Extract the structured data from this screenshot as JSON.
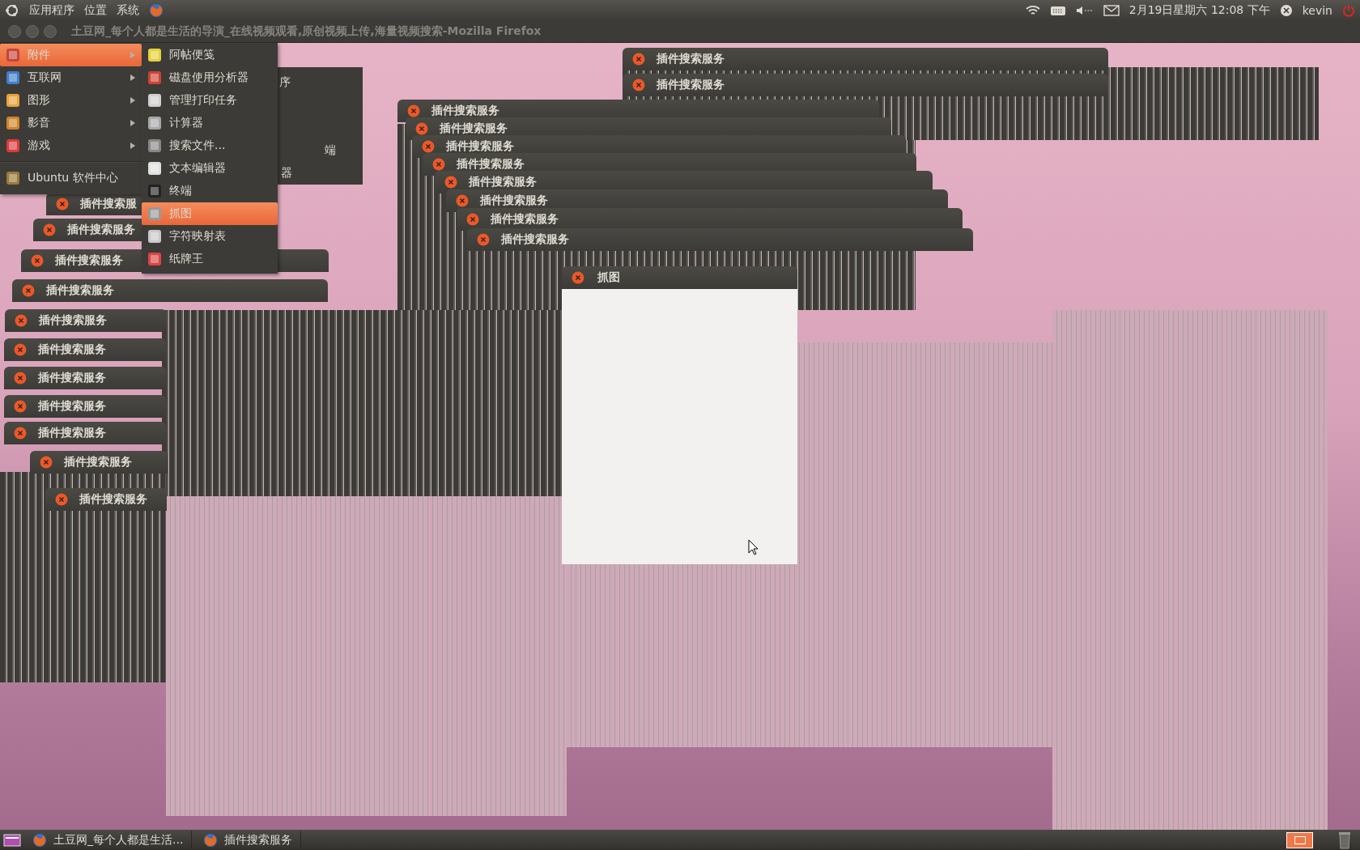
{
  "top_panel": {
    "menus": [
      {
        "label": "应用程序"
      },
      {
        "label": "位置"
      },
      {
        "label": "系统"
      }
    ],
    "clock": "2月19日星期六 12:08 下午",
    "user": "kevin"
  },
  "browser_titlebar": {
    "title": "土豆网_每个人都是生活的导演_在线视频观看,原创视频上传,海量视频搜索-Mozilla Firefox"
  },
  "fragments": [
    "序",
    "端",
    "器"
  ],
  "dialogs": [
    {
      "title": "插件搜索服务"
    },
    {
      "title": "插件搜索服务"
    },
    {
      "title": "插件搜索服务"
    },
    {
      "title": "插件搜索服务"
    },
    {
      "title": "插件搜索服务"
    },
    {
      "title": "插件搜索服务"
    },
    {
      "title": "插件搜索服务"
    },
    {
      "title": "插件搜索服务"
    },
    {
      "title": "插件搜索服务"
    },
    {
      "title": "插件搜索服务"
    },
    {
      "title": "插件搜索服"
    },
    {
      "title": "插件搜索服务"
    },
    {
      "title": "插件搜索服务"
    },
    {
      "title": "插件搜索服务"
    },
    {
      "title": "插件搜索服务"
    },
    {
      "title": "插件搜索服务"
    },
    {
      "title": "插件搜索服务"
    },
    {
      "title": "插件搜索服务"
    },
    {
      "title": "插件搜索服务"
    },
    {
      "title": "插件搜索服务"
    },
    {
      "title": "插件搜索服务"
    }
  ],
  "screenshot_dialog": {
    "title": "抓图"
  },
  "applications_menu": {
    "items": [
      {
        "label": "附件",
        "selected": true,
        "has_submenu": true
      },
      {
        "label": "互联网",
        "selected": false,
        "has_submenu": true
      },
      {
        "label": "图形",
        "selected": false,
        "has_submenu": true
      },
      {
        "label": "影音",
        "selected": false,
        "has_submenu": true
      },
      {
        "label": "游戏",
        "selected": false,
        "has_submenu": true
      },
      {
        "label": "Ubuntu 软件中心",
        "selected": false,
        "has_submenu": false
      }
    ]
  },
  "accessories_submenu": {
    "items": [
      {
        "label": "阿帖便笺",
        "selected": false
      },
      {
        "label": "磁盘使用分析器",
        "selected": false
      },
      {
        "label": "管理打印任务",
        "selected": false
      },
      {
        "label": "计算器",
        "selected": false
      },
      {
        "label": "搜索文件...",
        "selected": false
      },
      {
        "label": "文本编辑器",
        "selected": false
      },
      {
        "label": "终端",
        "selected": false
      },
      {
        "label": "抓图",
        "selected": true
      },
      {
        "label": "字符映射表",
        "selected": false
      },
      {
        "label": "纸牌王",
        "selected": false
      }
    ]
  },
  "taskbar": {
    "tasks": [
      {
        "label": "土豆网_每个人都是生活..."
      },
      {
        "label": "插件搜索服务"
      }
    ]
  }
}
